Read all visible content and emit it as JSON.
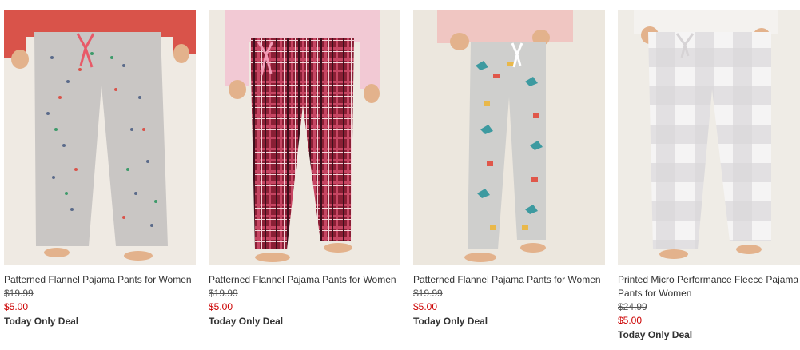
{
  "products": [
    {
      "title": "Patterned Flannel Pajama Pants for Women",
      "was_price": "$19.99",
      "sale_price": "$5.00",
      "deal": "Today Only Deal",
      "image": "gray-polka-dot-pajama-pants-photo",
      "pants_color": "#c9c6c4",
      "top_color": "#d9534a"
    },
    {
      "title": "Patterned Flannel Pajama Pants for Women",
      "was_price": "$19.99",
      "sale_price": "$5.00",
      "deal": "Today Only Deal",
      "image": "red-plaid-pajama-pants-photo",
      "pants_color": "#8a1f35",
      "top_color": "#f2c9d4"
    },
    {
      "title": "Patterned Flannel Pajama Pants for Women",
      "was_price": "$19.99",
      "sale_price": "$5.00",
      "deal": "Today Only Deal",
      "image": "gray-printed-pajama-pants-photo",
      "pants_color": "#cfcfcd",
      "top_color": "#f0c6c2"
    },
    {
      "title": "Printed Micro Performance Fleece Pajama Pants for Women",
      "was_price": "$24.99",
      "sale_price": "$5.00",
      "deal": "Today Only Deal",
      "image": "gray-buffalo-check-pajama-pants-photo",
      "pants_color": "#e0dfe0",
      "top_color": "#f4f2ef"
    }
  ]
}
